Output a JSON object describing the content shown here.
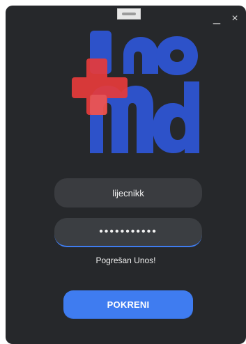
{
  "window": {
    "minimize_label": "_",
    "close_label": "×"
  },
  "login": {
    "username_value": "lijecnikk",
    "password_value": "•••••••••••",
    "error_message": "Pogrešan Unos!",
    "submit_label": "POKRENI"
  },
  "icons": {
    "logo": "inomd-logo",
    "drag_handle": "drag-handle-icon",
    "minimize": "minimize-icon",
    "close": "close-icon"
  },
  "colors": {
    "background": "#26282b",
    "field_background": "#3a3c40",
    "accent": "#3f7cf0",
    "logo_blue": "#2d52c9",
    "logo_red": "#e63b3b",
    "text": "#f2f2f2"
  }
}
